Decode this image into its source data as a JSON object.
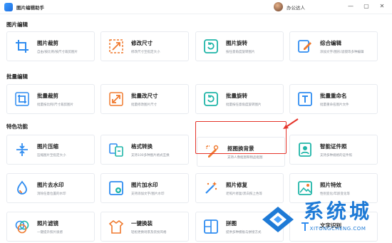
{
  "titlebar": {
    "app_title": "图片编辑助手",
    "user_name": "办公达人",
    "min_symbol": "—",
    "max_symbol": "▢",
    "close_symbol": "✕"
  },
  "sections": {
    "image_edit": "图片编辑",
    "batch_edit": "批量编辑",
    "features": "特色功能"
  },
  "cards": [
    {
      "name": "图片裁剪",
      "desc": "自由/按比例/按尺寸裁剪图片",
      "icon": "crop-icon"
    },
    {
      "name": "修改尺寸",
      "desc": "修改尺寸至指定大小",
      "icon": "resize-icon"
    },
    {
      "name": "图片旋转",
      "desc": "按任意角度旋转图片",
      "icon": "rotate-icon"
    },
    {
      "name": "综合编辑",
      "desc": "添加文字/图形/滤镜等多种编辑",
      "icon": "edit-icon"
    },
    {
      "name": "批量裁剪",
      "desc": "批量按比例/尺寸裁剪图片",
      "icon": "batch-crop-icon"
    },
    {
      "name": "批量改尺寸",
      "desc": "批量修改图片尺寸",
      "icon": "batch-resize-icon"
    },
    {
      "name": "批量旋转",
      "desc": "批量按任意角度旋转图片",
      "icon": "batch-rotate-icon"
    },
    {
      "name": "批量重命名",
      "desc": "批量重命名图片文件",
      "icon": "rename-icon"
    },
    {
      "name": "图片压缩",
      "desc": "压缩图片至指定大小",
      "icon": "compress-icon"
    },
    {
      "name": "格式转换",
      "desc": "支持100多种图片格式互换",
      "icon": "convert-icon"
    },
    {
      "name": "抠图换背景",
      "desc": "支持人像抠图和物品抠图",
      "icon": "cutout-icon"
    },
    {
      "name": "智能证件照",
      "desc": "支持多种规格的证件照",
      "icon": "id-photo-icon"
    },
    {
      "name": "图片去水印",
      "desc": "消除任意位置的水印",
      "icon": "remove-watermark-icon"
    },
    {
      "name": "图片加水印",
      "desc": "支持添加文字/图片水印",
      "icon": "add-watermark-icon"
    },
    {
      "name": "照片修复",
      "desc": "老照片修复/黑白照上色等",
      "icon": "magic-wand-icon"
    },
    {
      "name": "照片特效",
      "desc": "性别变化/年龄变化等",
      "icon": "effects-icon"
    },
    {
      "name": "照片滤镜",
      "desc": "一键提升照片质感",
      "icon": "filter-icon"
    },
    {
      "name": "一键换装",
      "desc": "轻松更换场景及装扮风格",
      "icon": "outfit-icon"
    },
    {
      "name": "拼图",
      "desc": "提供多种模板与拼接方式",
      "icon": "collage-icon"
    },
    {
      "name": "文字识别",
      "desc": "",
      "icon": "text-recognition-icon"
    }
  ],
  "watermark": {
    "cn": "系统城",
    "en": "XITONGCHENG.COM"
  },
  "colors": {
    "accent": "#1e7ad6",
    "icon_blue": "#2f8cf0",
    "icon_orange": "#f07a2f",
    "icon_teal": "#1fb5a8",
    "highlight_red": "#e5352b"
  }
}
